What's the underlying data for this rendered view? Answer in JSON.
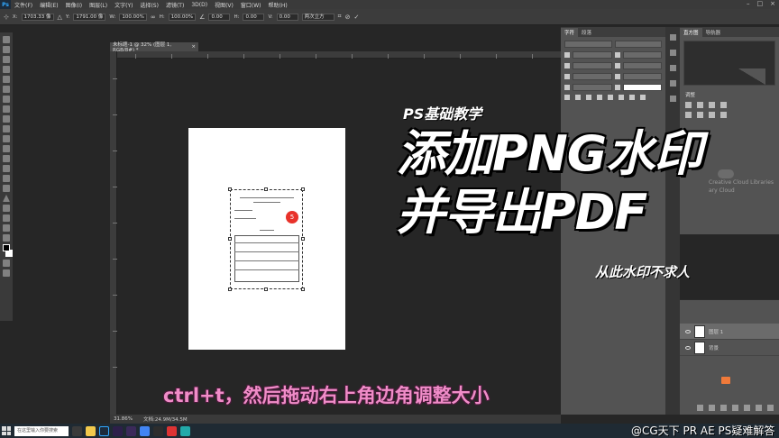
{
  "app": {
    "logo": "Ps"
  },
  "menu": [
    "文件(F)",
    "编辑(E)",
    "图像(I)",
    "图层(L)",
    "文字(Y)",
    "选择(S)",
    "滤镜(T)",
    "3D(D)",
    "视图(V)",
    "窗口(W)",
    "帮助(H)"
  ],
  "window_controls": [
    "–",
    "□",
    "×"
  ],
  "options": {
    "x_value": "1703.33 像",
    "y_value": "1791.00 像",
    "w_value": "100.00%",
    "h_value": "100.00%",
    "angle_value": "0.00",
    "h_skew": "0.00",
    "v_skew": "0.00",
    "interp": "两次立方"
  },
  "document": {
    "tab_title": "未标题-1 @ 32% (图层 1, RGB/8#) *",
    "close": "×",
    "stamp_glyph": "5"
  },
  "status": {
    "zoom": "31.86%",
    "doc_size": "文档:24.9M/34.5M"
  },
  "char_panel": {
    "tabs": [
      "字符",
      "段落"
    ]
  },
  "history_panel": {
    "tabs": [
      "直方图",
      "导航器"
    ],
    "adjust_label": "调整"
  },
  "cloud_text": [
    "Creative Cloud Libraries",
    "ary Cloud"
  ],
  "layers": [
    {
      "name": "图层 1",
      "selected": true
    },
    {
      "name": "背景",
      "selected": false
    }
  ],
  "overlay": {
    "subtitle_top": "PS基础教学",
    "title_line1": "添加PNG水印",
    "title_line2": "并导出PDF",
    "tagline": "从此水印不求人",
    "caption": "ctrl+t，然后拖动右上角边角调整大小"
  },
  "taskbar": {
    "search_placeholder": "在这里输入你要搜索",
    "watermark": "@CG天下 PR AE PS疑难解答"
  },
  "colors": {
    "ps_blue": "#31a8ff",
    "caption_pink": "#f08cc8",
    "stamp_red": "#e8322a"
  }
}
